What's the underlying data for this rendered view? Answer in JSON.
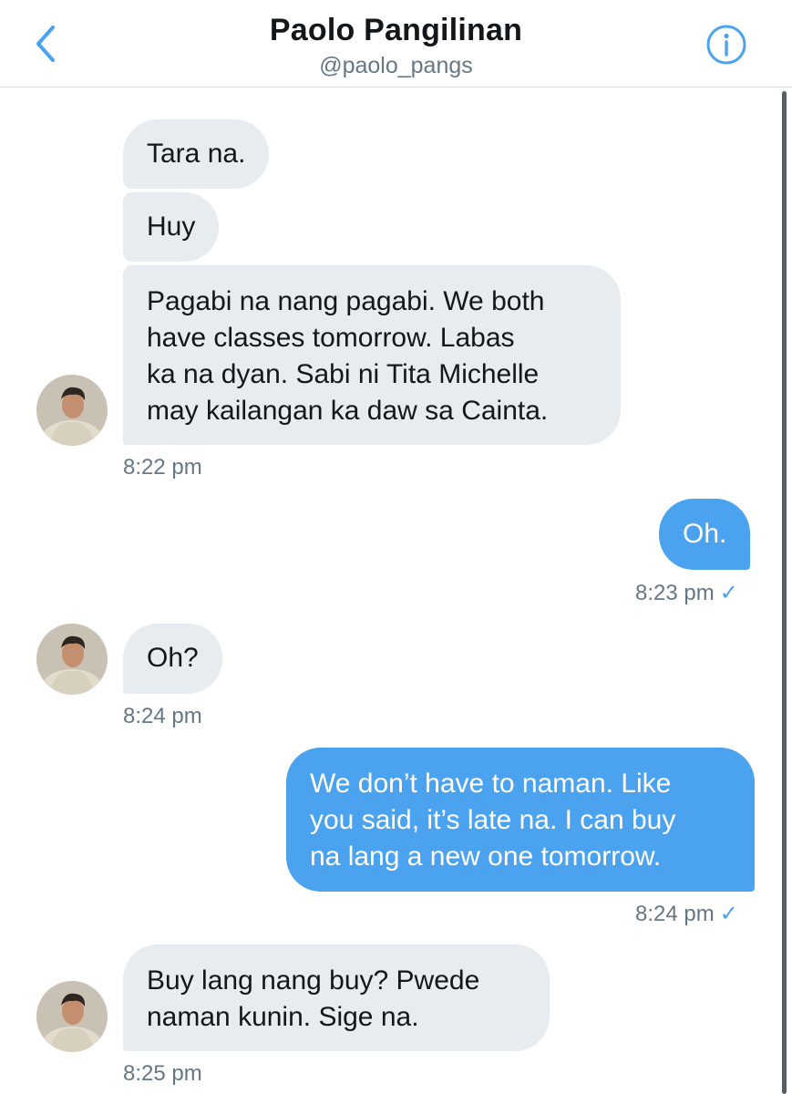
{
  "header": {
    "name": "Paolo Pangilinan",
    "handle": "@paolo_pangs",
    "back_icon": "chevron-left-icon",
    "info_icon": "info-circle-icon",
    "accent_color": "#4ba3ef"
  },
  "messages": [
    {
      "direction": "in",
      "text": "Tara na."
    },
    {
      "direction": "in",
      "text": "Huy"
    },
    {
      "direction": "in",
      "lines": [
        "Pagabi na nang pagabi. We both",
        "have classes tomorrow. Labas",
        "ka na dyan. Sabi ni Tita Michelle",
        "may kailangan ka daw sa Cainta."
      ],
      "time": "8:22 pm"
    },
    {
      "direction": "out",
      "text": "Oh.",
      "time": "8:23 pm",
      "read_mark": "✓"
    },
    {
      "direction": "in",
      "text": "Oh?",
      "time": "8:24 pm"
    },
    {
      "direction": "out",
      "lines": [
        "We don’t have to naman. Like",
        "you said, it’s late na. I can buy",
        "na lang a new one tomorrow."
      ],
      "time": "8:24 pm",
      "read_mark": "✓"
    },
    {
      "direction": "in",
      "lines": [
        "Buy lang nang buy? Pwede",
        "naman kunin. Sige na."
      ],
      "time": "8:25 pm"
    }
  ]
}
